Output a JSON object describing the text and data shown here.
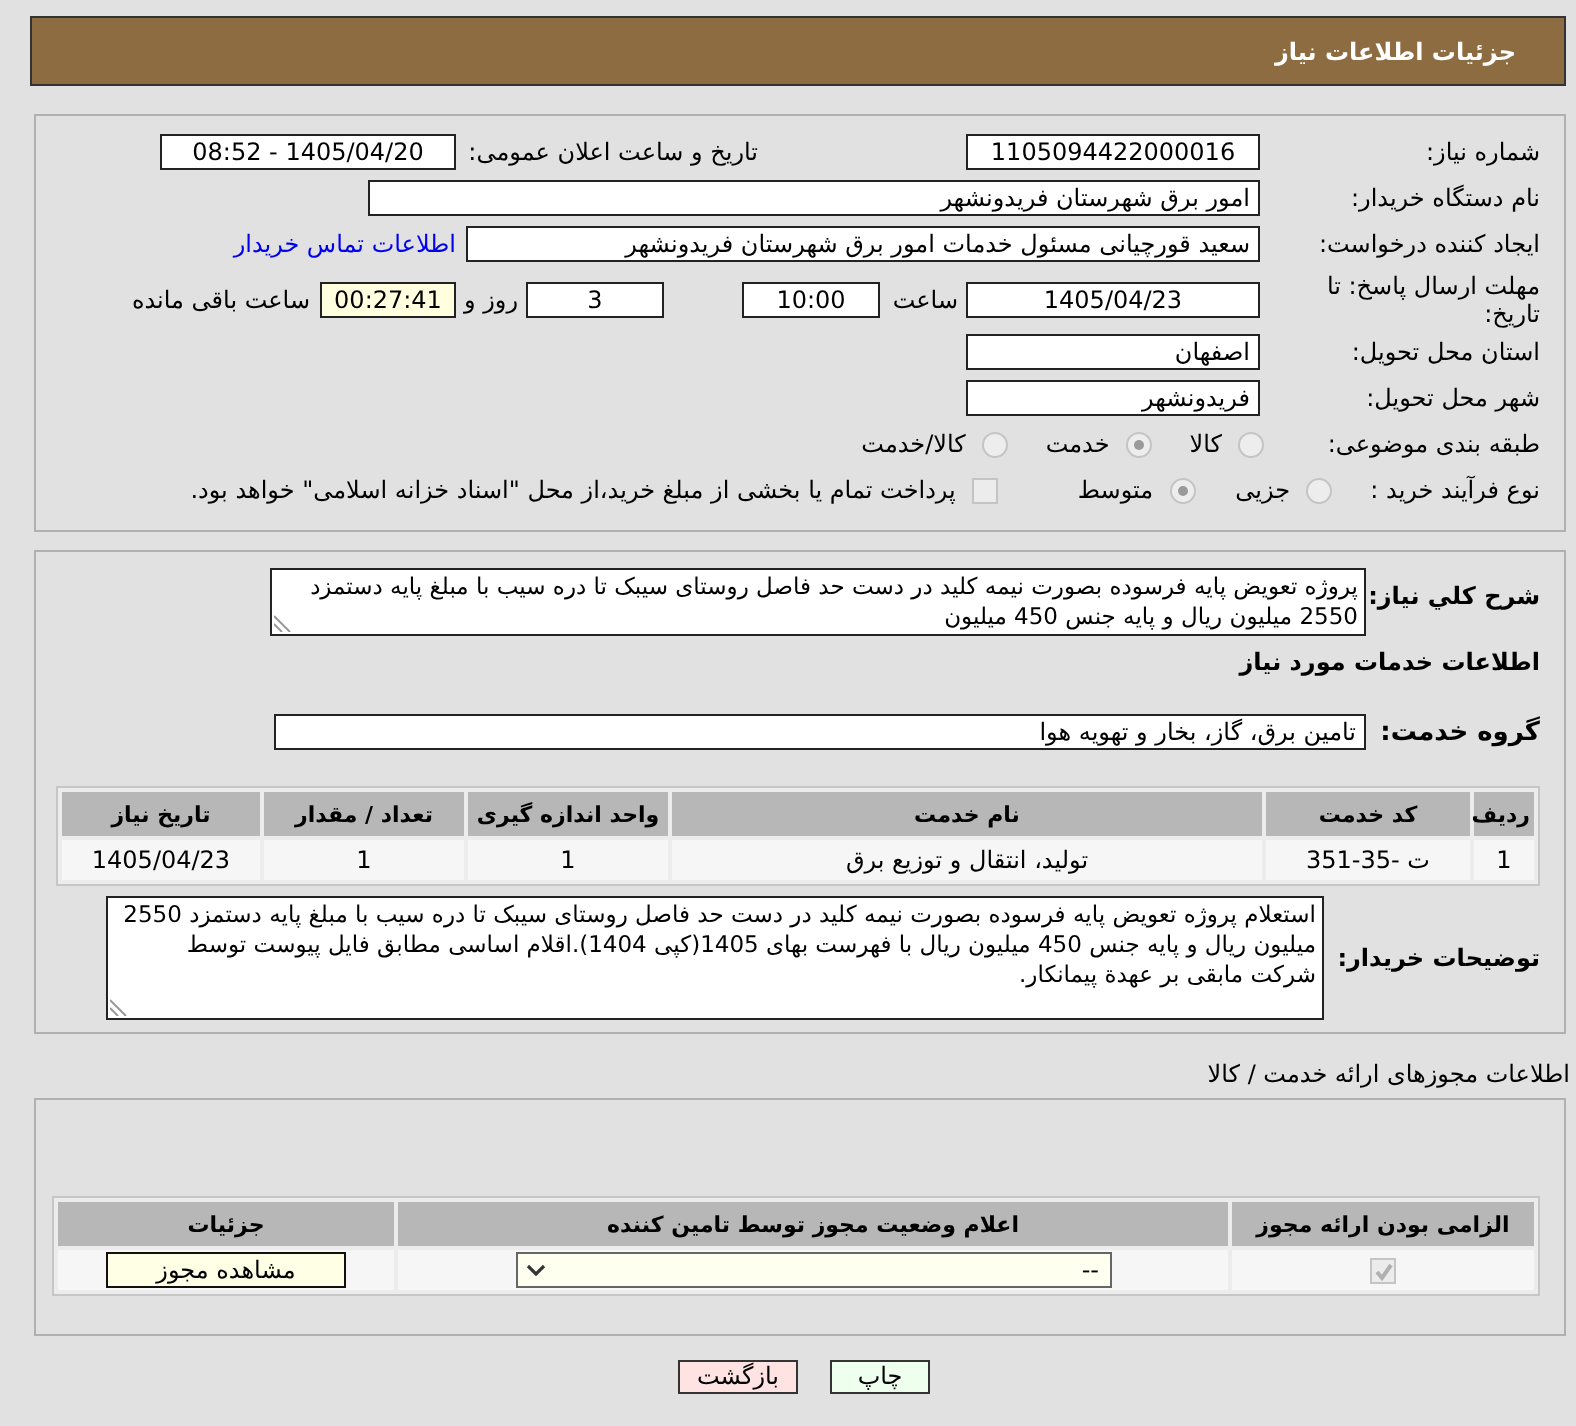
{
  "header": {
    "title": "جزئیات اطلاعات نیاز"
  },
  "details": {
    "need_number": {
      "label": "شماره نیاز:",
      "value": "1105094422000016"
    },
    "announce": {
      "label": "تاریخ و ساعت اعلان عمومی:",
      "value": "1405/04/20 - 08:52"
    },
    "buyer": {
      "label": "نام دستگاه خریدار:",
      "value": "امور برق شهرستان فریدونشهر"
    },
    "requester": {
      "label": "ایجاد کننده درخواست:",
      "value": "سعید قورچیانی مسئول خدمات امور برق شهرستان فریدونشهر",
      "link": "اطلاعات تماس خریدار"
    },
    "deadline": {
      "label": "مهلت ارسال پاسخ: تا تاریخ:",
      "date": "1405/04/23",
      "time_label": "ساعت",
      "time": "10:00",
      "days": "3",
      "days_label": "روز و",
      "remaining": "00:27:41",
      "remaining_label": "ساعت باقی مانده"
    },
    "province": {
      "label": "استان محل تحویل:",
      "value": "اصفهان"
    },
    "city": {
      "label": "شهر محل تحویل:",
      "value": "فریدونشهر"
    },
    "category": {
      "label": "طبقه بندی موضوعی:",
      "disabled": true,
      "options": [
        {
          "label": "کالا",
          "selected": false
        },
        {
          "label": "خدمت",
          "selected": true
        },
        {
          "label": "کالا/خدمت",
          "selected": false
        }
      ]
    },
    "process": {
      "label": "نوع فرآیند خرید :",
      "disabled": true,
      "options": [
        {
          "label": "جزیی",
          "selected": false
        },
        {
          "label": "متوسط",
          "selected": true
        }
      ],
      "treasury": {
        "label": "پرداخت تمام یا بخشی از مبلغ خرید،از محل \"اسناد خزانه اسلامی\" خواهد بود.",
        "checked": false,
        "disabled": true
      }
    }
  },
  "summary": {
    "label": "شرح کلي نياز:",
    "text": "پروژه تعویض پایه فرسوده بصورت نیمه کلید در دست حد فاصل روستای سیبک تا دره سیب با مبلغ پایه دستمزد 2550 میلیون ریال و پایه جنس 450 میلیون"
  },
  "services": {
    "heading": "اطلاعات خدمات مورد نياز",
    "group": {
      "label": "گروه خدمت:",
      "value": "تامین برق، گاز، بخار و تهویه هوا"
    },
    "table": {
      "columns": [
        "ردیف",
        "کد خدمت",
        "نام خدمت",
        "واحد اندازه گیری",
        "تعداد / مقدار",
        "تاریخ نیاز"
      ],
      "rows": [
        [
          "1",
          "ت -35-351",
          "تولید، انتقال و توزیع برق",
          "1",
          "1",
          "1405/04/23"
        ]
      ]
    }
  },
  "buyer_notes": {
    "label": "توضیحات خریدار:",
    "text": "استعلام پروژه تعویض پایه فرسوده بصورت نیمه کلید در دست حد فاصل روستای سیبک تا دره سیب با مبلغ پایه دستمزد 2550 میلیون ریال و پایه جنس 450 میلیون ریال با فهرست بهای 1405(کپی 1404).اقلام اساسی مطابق فایل پیوست توسط شرکت مابقی بر عهدة پیمانکار."
  },
  "permits": {
    "title": "اطلاعات مجوزهای ارائه خدمت / کالا",
    "columns": [
      "الزامی بودن ارائه مجوز",
      "اعلام وضعیت مجوز توسط تامین کننده",
      "جزئیات"
    ],
    "rows": [
      {
        "required": {
          "checked": true,
          "disabled": true
        },
        "status": "--",
        "action": "مشاهده مجوز"
      }
    ]
  },
  "buttons": [
    {
      "label": "چاپ",
      "kind": "print"
    },
    {
      "label": "بازگشت",
      "kind": "back"
    }
  ]
}
